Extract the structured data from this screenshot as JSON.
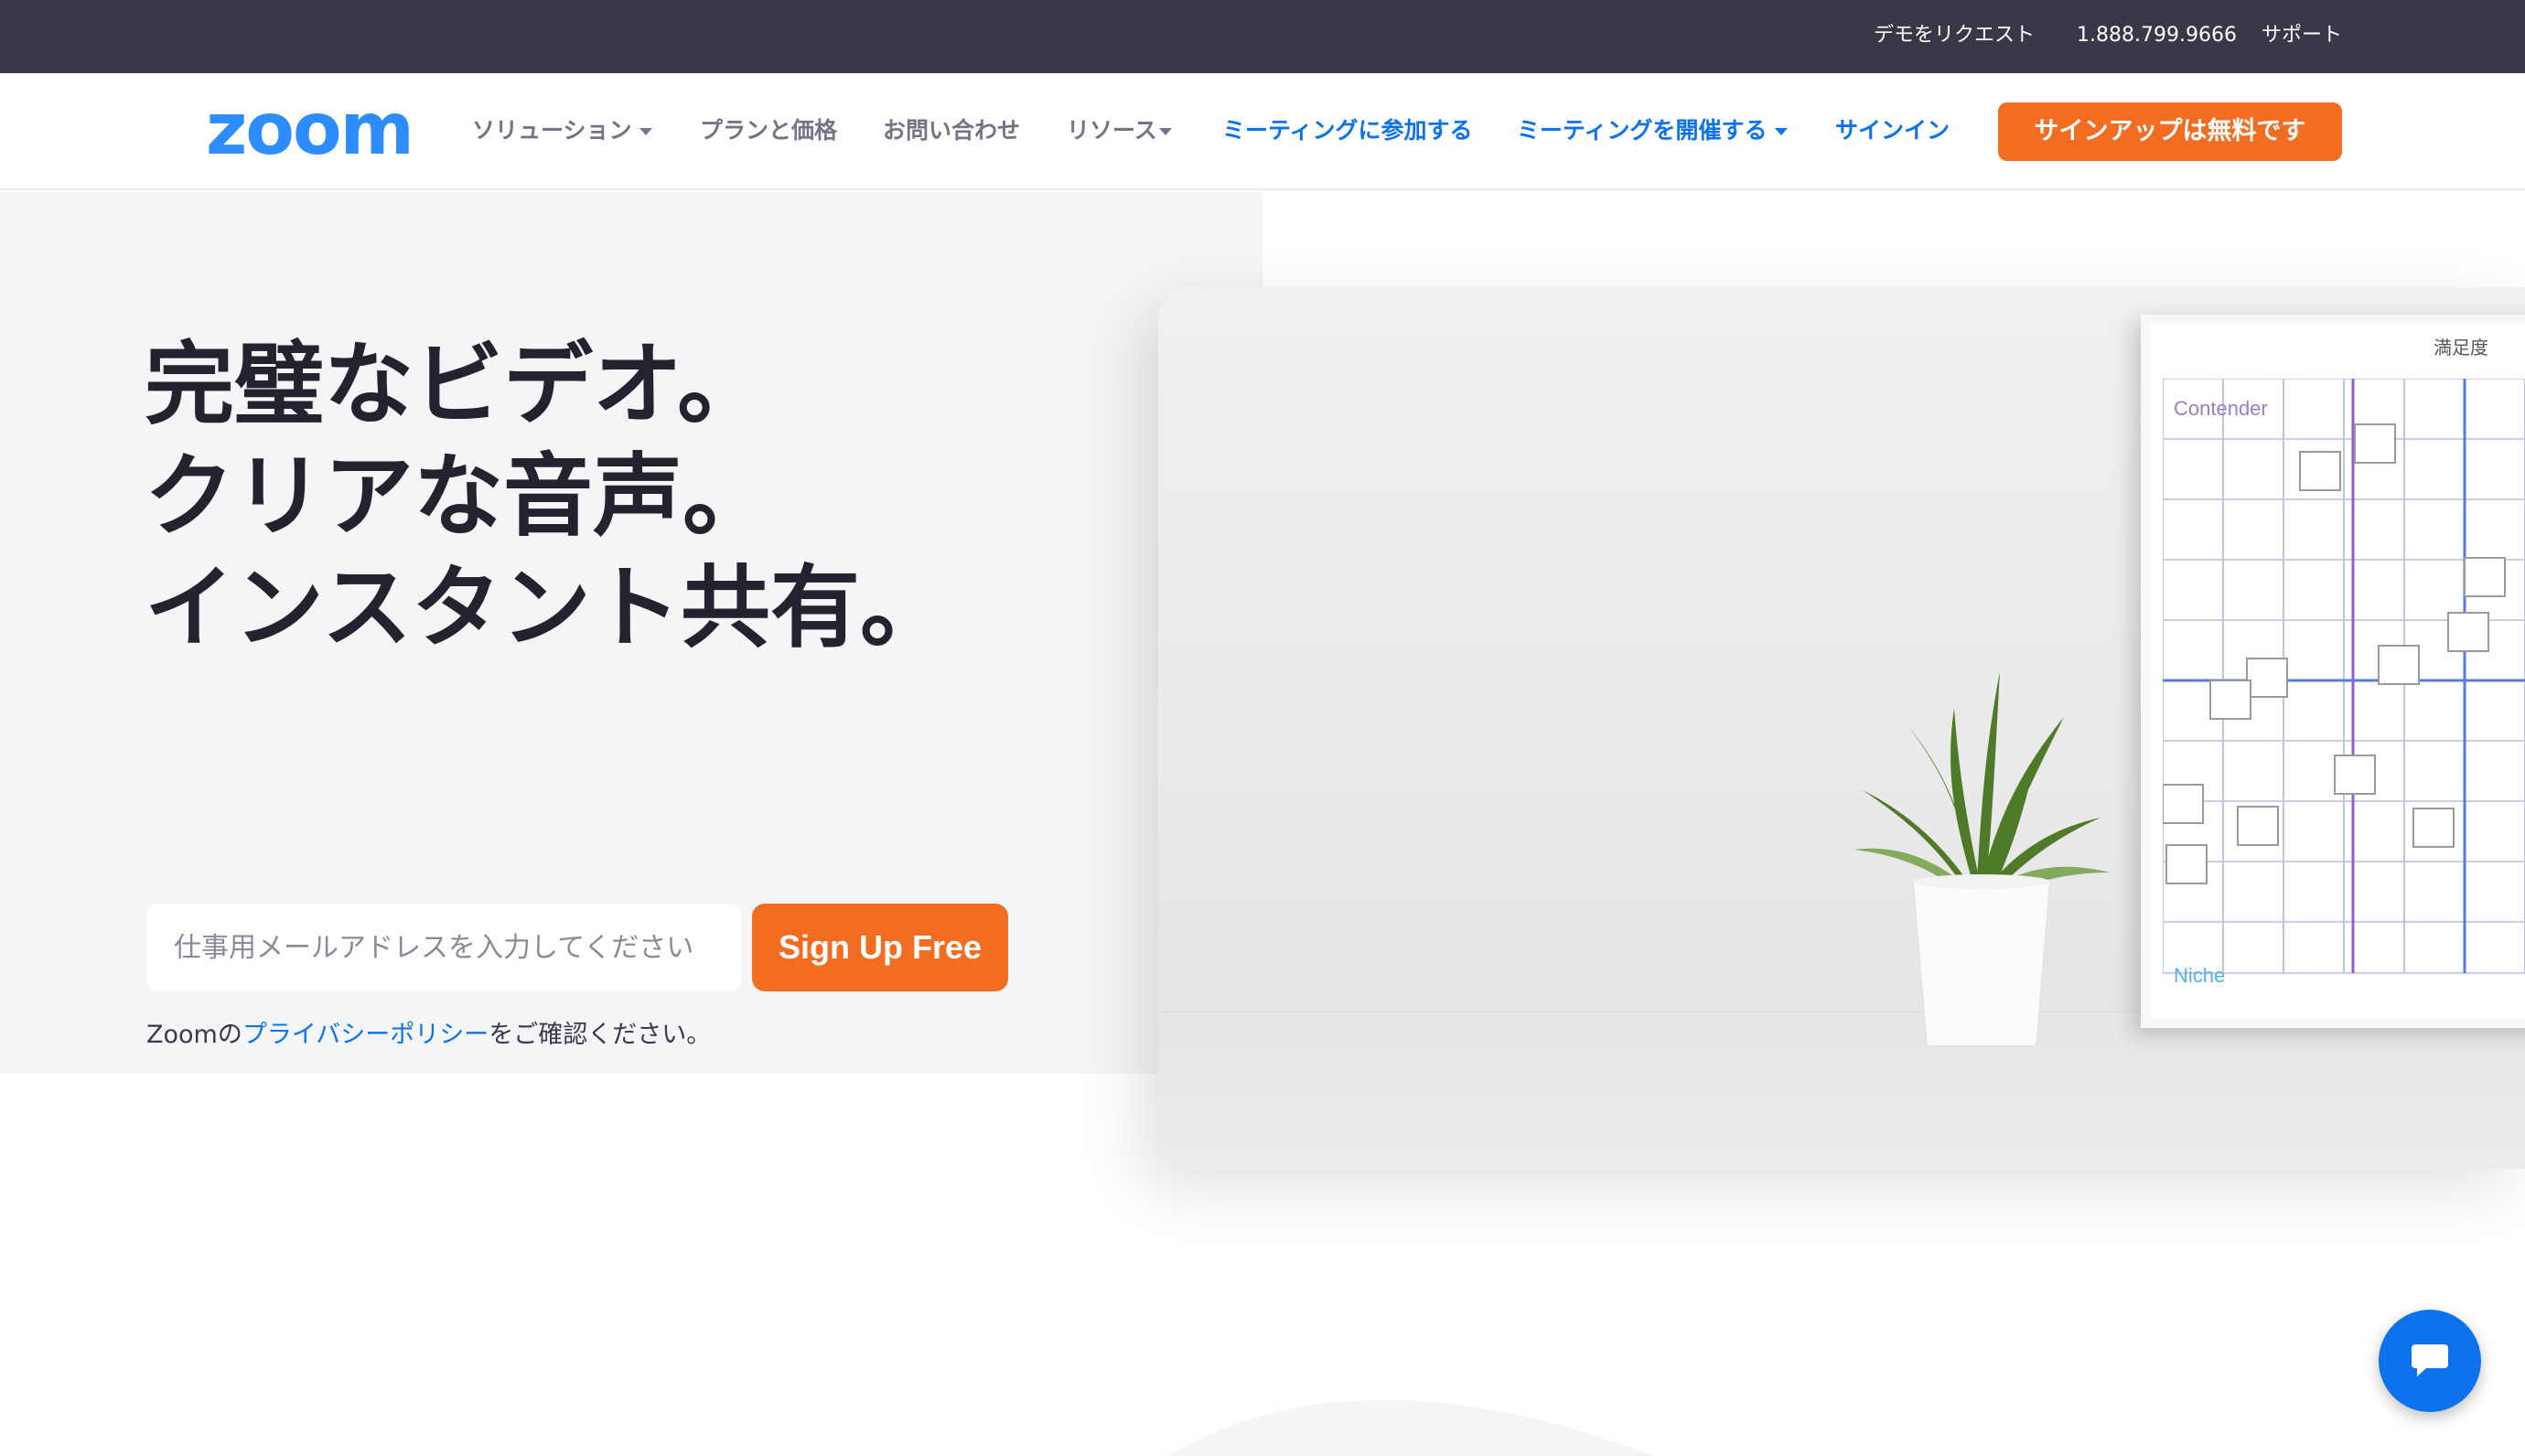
{
  "utility_bar": {
    "demo_request": "デモをリクエスト",
    "phone": "1.888.799.9666",
    "support": "サポート"
  },
  "brand": {
    "logo_text": "zoom",
    "logo_color": "#2d8cff"
  },
  "nav": {
    "solutions": "ソリューション",
    "plans": "プランと価格",
    "contact": "お問い合わせ",
    "resources": "リソース",
    "join_meeting": "ミーティングに参加する",
    "host_meeting": "ミーティングを開催する",
    "sign_in": "サインイン",
    "sign_up_free": "サインアップは無料です"
  },
  "hero": {
    "headline_line1": "完璧なビデオ。",
    "headline_line2": "クリアな音声。",
    "headline_line3": "インスタント共有。",
    "email_placeholder": "仕事用メールアドレスを入力してください",
    "signup_button": "Sign Up Free",
    "privacy_prefix": "Zoomの",
    "privacy_link": "プライバシーポリシー",
    "privacy_suffix": "をご確認ください。"
  },
  "hero_image": {
    "frame_header": "満足度",
    "contender_label": "Contender",
    "niche_label": "Niche"
  },
  "colors": {
    "accent_orange": "#f26d21",
    "brand_blue": "#0e72ed",
    "utility_bar": "#383848",
    "hero_bg": "#f4f5f7"
  },
  "icons": {
    "chat": "chat-bubble-icon"
  }
}
